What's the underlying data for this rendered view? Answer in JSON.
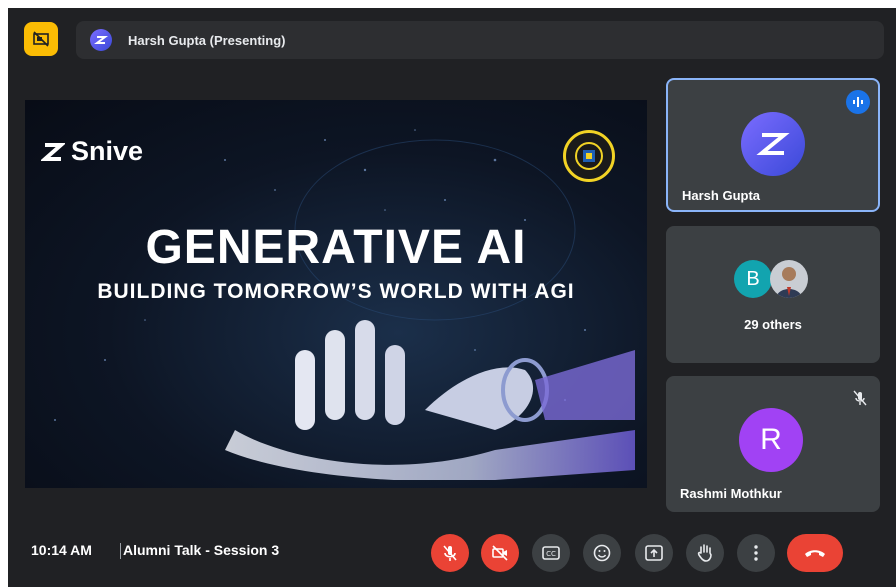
{
  "top_bar": {
    "presenter_label": "Harsh Gupta (Presenting)",
    "tile_toggle_icon": "hide-tiles-icon",
    "presenter_icon": "snive-logo-icon"
  },
  "slide": {
    "brand": "Snive",
    "title": "GENERATIVE AI",
    "subtitle": "BUILDING TOMORROW’S WORLD WITH AGI"
  },
  "participants": [
    {
      "name": "Harsh Gupta",
      "avatar": "snive-logo",
      "speaking": true,
      "accent": "#8ab4f8"
    },
    {
      "initial": "B",
      "label": "29 others",
      "avatar_color": "#12a4af"
    },
    {
      "name": "Rashmi Mothkur",
      "initial": "R",
      "avatar_color": "#a142f4",
      "muted": true
    }
  ],
  "bottom_bar": {
    "time": "10:14 AM",
    "meeting_title": "Alumni Talk - Session 3",
    "controls": [
      {
        "icon": "mic-off-icon",
        "state": "off"
      },
      {
        "icon": "camera-off-icon",
        "state": "off"
      },
      {
        "icon": "captions-icon"
      },
      {
        "icon": "emoji-icon"
      },
      {
        "icon": "present-screen-icon"
      },
      {
        "icon": "raise-hand-icon"
      },
      {
        "icon": "more-options-icon"
      },
      {
        "icon": "end-call-icon"
      }
    ]
  },
  "colors": {
    "background": "#202124",
    "tile": "#3c4043",
    "danger": "#ea4335",
    "highlight": "#fbbc04"
  }
}
